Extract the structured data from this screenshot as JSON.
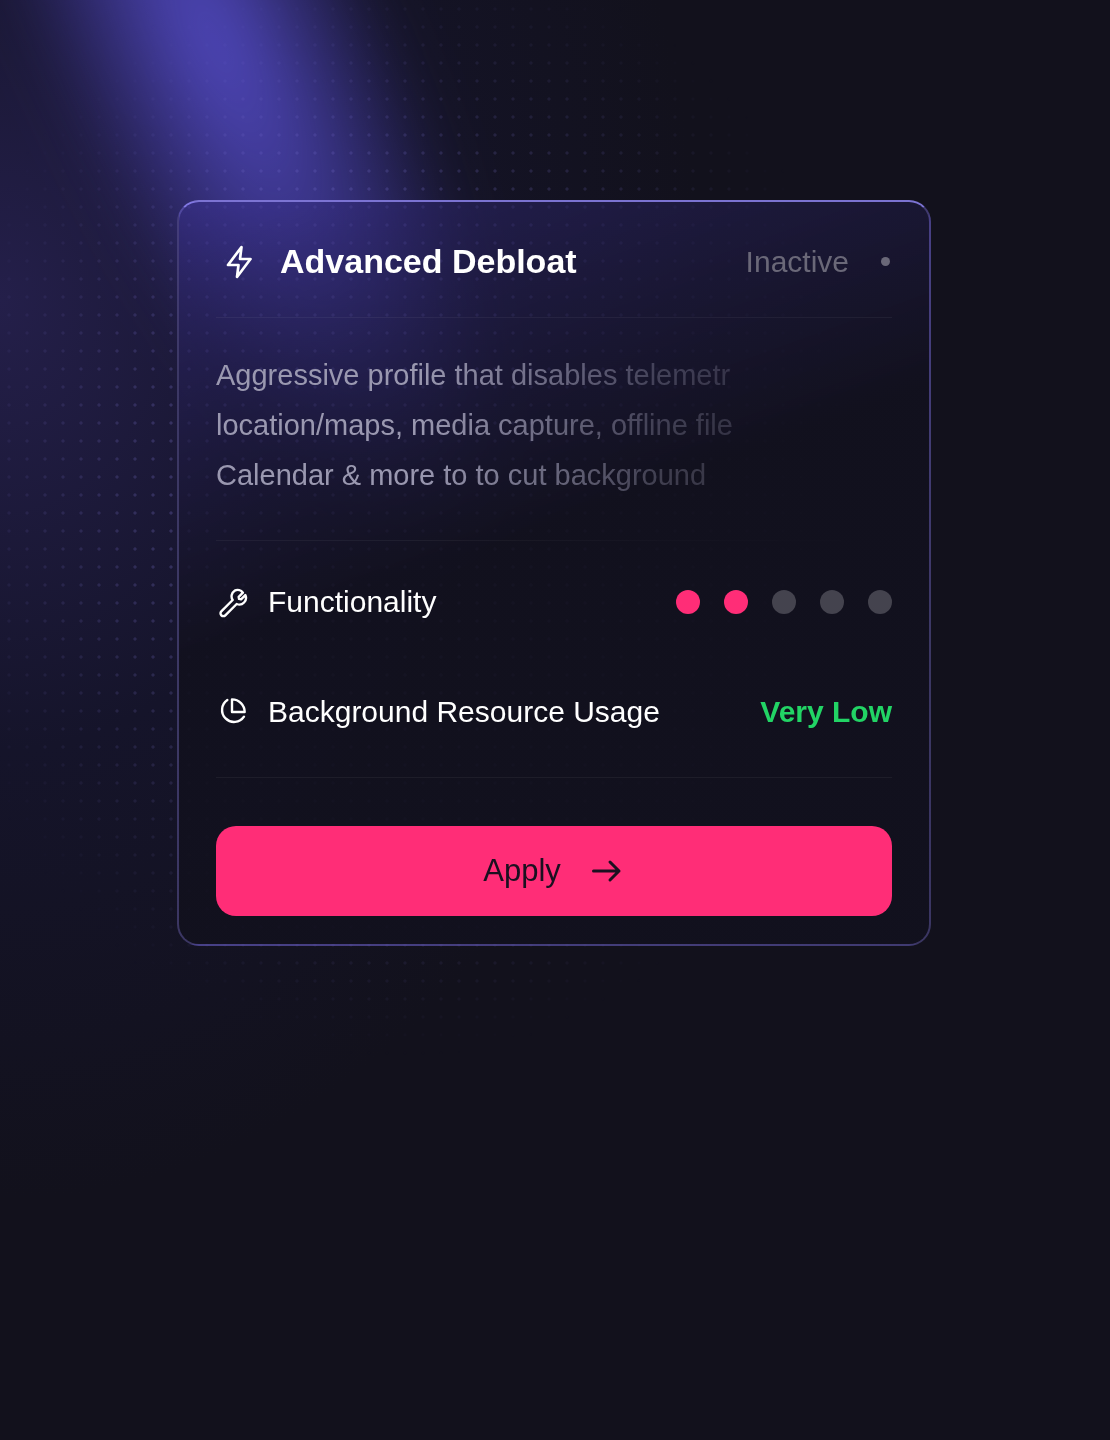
{
  "card": {
    "title": "Advanced Debloat",
    "status": {
      "label": "Inactive",
      "active": false
    },
    "description": [
      "Aggressive profile that disables telemetr",
      "location/maps, media capture, offline file",
      "Calendar & more to to cut background"
    ],
    "metrics": [
      {
        "kind": "dots",
        "label": "Functionality",
        "stars": 2
      },
      {
        "kind": "value",
        "label": "Background Resource Usage",
        "value": "Very Low",
        "color": "#22d465"
      }
    ],
    "button": {
      "label": "Apply"
    }
  }
}
